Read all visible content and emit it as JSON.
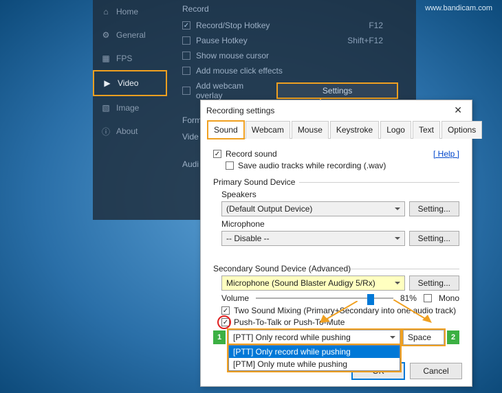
{
  "watermark": "www.bandicam.com",
  "sidebar": {
    "items": [
      {
        "label": "Home"
      },
      {
        "label": "General"
      },
      {
        "label": "FPS"
      },
      {
        "label": "Video"
      },
      {
        "label": "Image"
      },
      {
        "label": "About"
      }
    ]
  },
  "record_section": {
    "title": "Record",
    "rows": [
      {
        "label": "Record/Stop Hotkey",
        "value": "F12",
        "checked": true
      },
      {
        "label": "Pause Hotkey",
        "value": "Shift+F12",
        "checked": false
      },
      {
        "label": "Show mouse cursor",
        "checked": false
      },
      {
        "label": "Add mouse click effects",
        "checked": false
      },
      {
        "label": "Add webcam overlay",
        "checked": false
      }
    ],
    "settings_button": "Settings"
  },
  "format_section": {
    "title": "Format",
    "video_label": "Vide",
    "audio_label": "Audi"
  },
  "dialog": {
    "title": "Recording settings",
    "tabs": [
      "Sound",
      "Webcam",
      "Mouse",
      "Keystroke",
      "Logo",
      "Text",
      "Options"
    ],
    "record_sound": "Record sound",
    "save_tracks": "Save audio tracks while recording (.wav)",
    "help": "[ Help ]",
    "primary": {
      "title": "Primary Sound Device",
      "speakers": "Speakers",
      "speakers_value": "(Default Output Device)",
      "mic": "Microphone",
      "mic_value": "-- Disable --",
      "setting": "Setting..."
    },
    "secondary": {
      "title": "Secondary Sound Device (Advanced)",
      "device_value": "Microphone (Sound Blaster Audigy 5/Rx)",
      "setting": "Setting...",
      "volume": "Volume",
      "volume_pct": "81%",
      "mono": "Mono",
      "two_mixing": "Two Sound Mixing (Primary+Secondary into one audio track)",
      "ptt": "Push-To-Talk or Push-To-Mute",
      "ptt_selected": "[PTT] Only record while pushing",
      "ptt_options": [
        "[PTT] Only record while pushing",
        "[PTM] Only mute while pushing"
      ],
      "ptt_key": "Space",
      "badge1": "1",
      "badge2": "2"
    },
    "ok": "OK",
    "cancel": "Cancel"
  }
}
